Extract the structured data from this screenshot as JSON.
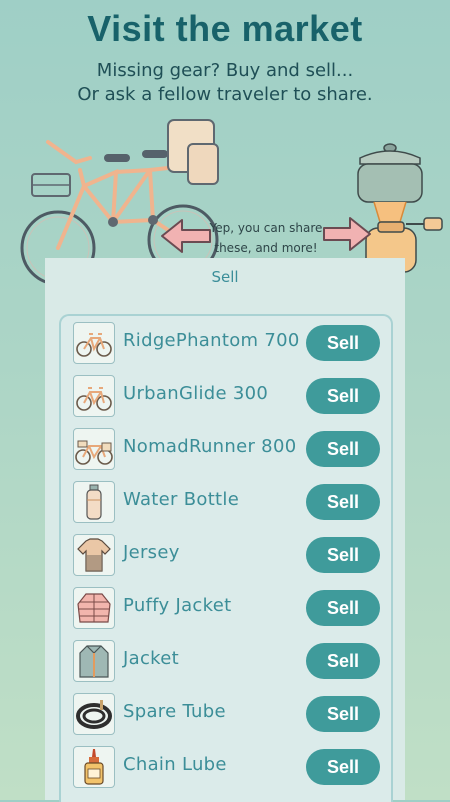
{
  "header": {
    "title": "Visit the market",
    "subtitle_line1": "Missing gear? Buy and sell...",
    "subtitle_line2": "Or ask a fellow traveler to share."
  },
  "illustration": {
    "caption_line1": "Yep, you can share",
    "caption_line2": "these, and more!",
    "left_icon": "tandem-bicycle",
    "right_icon": "camping-stove"
  },
  "panel": {
    "header": "Sell",
    "items": [
      {
        "label": "RidgePhantom 700",
        "button": "Sell",
        "icon": "bike-icon"
      },
      {
        "label": "UrbanGlide 300",
        "button": "Sell",
        "icon": "bike-icon"
      },
      {
        "label": "NomadRunner 800",
        "button": "Sell",
        "icon": "touring-bike-icon"
      },
      {
        "label": "Water Bottle",
        "button": "Sell",
        "icon": "water-bottle-icon"
      },
      {
        "label": "Jersey",
        "button": "Sell",
        "icon": "jersey-icon"
      },
      {
        "label": "Puffy Jacket",
        "button": "Sell",
        "icon": "puffy-jacket-icon"
      },
      {
        "label": "Jacket",
        "button": "Sell",
        "icon": "jacket-icon"
      },
      {
        "label": "Spare Tube",
        "button": "Sell",
        "icon": "tube-icon"
      },
      {
        "label": "Chain Lube",
        "button": "Sell",
        "icon": "lube-bottle-icon"
      }
    ]
  },
  "colors": {
    "title": "#18626a",
    "accent": "#3f9b9b",
    "label": "#3c8e98",
    "arrow": "#f1b2b2"
  }
}
